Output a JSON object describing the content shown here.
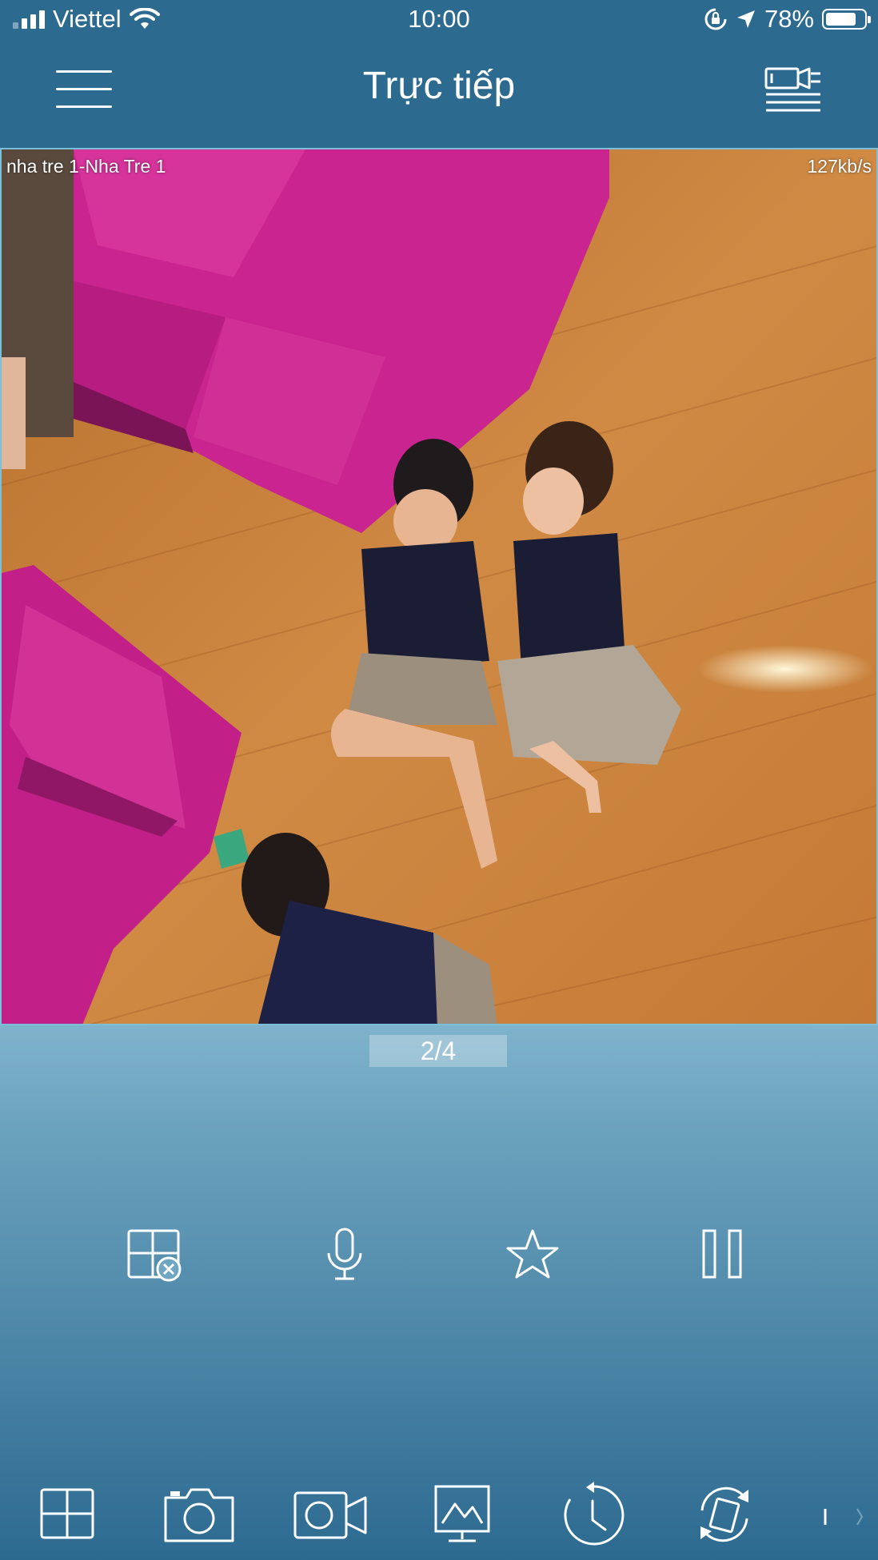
{
  "status_bar": {
    "carrier": "Viettel",
    "time": "10:00",
    "battery_percent": "78%",
    "battery_level": 0.78,
    "icons": [
      "signal-icon",
      "wifi-icon",
      "rotation-lock-icon",
      "location-arrow-icon",
      "battery-icon"
    ]
  },
  "navbar": {
    "title": "Trực tiếp",
    "left_icon": "menu-icon",
    "right_icon": "camera-list-icon"
  },
  "video": {
    "camera_name": "nha tre 1-Nha Tre 1",
    "bitrate": "127kb/s"
  },
  "pager": {
    "label": "2/4"
  },
  "controls": [
    {
      "icon": "close-window-icon",
      "label": "close-window"
    },
    {
      "icon": "microphone-icon",
      "label": "microphone"
    },
    {
      "icon": "star-icon",
      "label": "favorite"
    },
    {
      "icon": "pause-icon",
      "label": "pause"
    }
  ],
  "toolbar": [
    {
      "icon": "split-screen-icon"
    },
    {
      "icon": "snapshot-camera-icon"
    },
    {
      "icon": "record-video-icon"
    },
    {
      "icon": "quality-monitor-icon"
    },
    {
      "icon": "playback-clock-icon"
    },
    {
      "icon": "switch-stream-icon"
    }
  ],
  "colors": {
    "header": "#2c6a8f",
    "accent_border": "#79c0d8",
    "panel_mid": "#7fb3cc"
  }
}
